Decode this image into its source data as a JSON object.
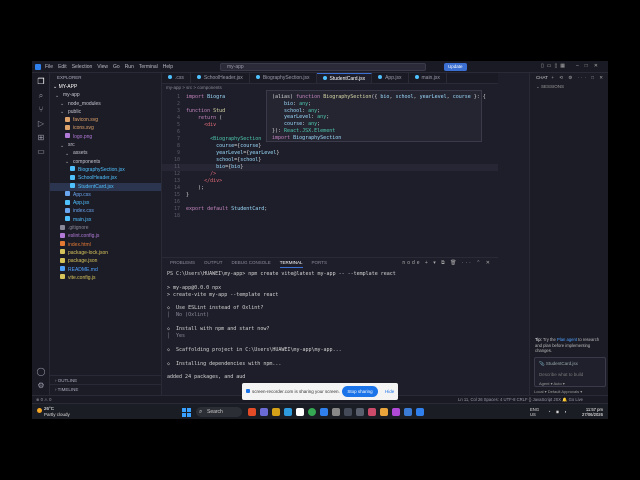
{
  "titlebar": {
    "menu": [
      "File",
      "Edit",
      "Selection",
      "View",
      "Go",
      "Run",
      "Terminal",
      "Help"
    ],
    "search": "my-app",
    "update_label": "Update"
  },
  "explorer": {
    "title": "EXPLORER",
    "root": "MY-APP",
    "items": [
      {
        "label": "my-app",
        "indent": 0,
        "color": "#c5c5d0",
        "kind": "folder"
      },
      {
        "label": "node_modules",
        "indent": 1,
        "color": "#8a8a9a",
        "kind": "folder"
      },
      {
        "label": "public",
        "indent": 1,
        "color": "#c5c5d0",
        "kind": "folder"
      },
      {
        "label": "favicon.svg",
        "indent": 2,
        "color": "#e0a46a",
        "kind": "file"
      },
      {
        "label": "icons.svg",
        "indent": 2,
        "color": "#e0a46a",
        "kind": "file"
      },
      {
        "label": "logo.png",
        "indent": 2,
        "color": "#b07ad6",
        "kind": "file"
      },
      {
        "label": "src",
        "indent": 1,
        "color": "#c5c5d0",
        "kind": "folder"
      },
      {
        "label": "assets",
        "indent": 2,
        "color": "#c5c5d0",
        "kind": "folder"
      },
      {
        "label": "components",
        "indent": 2,
        "color": "#c5c5d0",
        "kind": "folder"
      },
      {
        "label": "BiographySection.jsx",
        "indent": 3,
        "color": "#4fc1ff",
        "kind": "file"
      },
      {
        "label": "SchoolHeader.jsx",
        "indent": 3,
        "color": "#4fc1ff",
        "kind": "file"
      },
      {
        "label": "StudentCard.jsx",
        "indent": 3,
        "color": "#4fc1ff",
        "kind": "file",
        "selected": true
      },
      {
        "label": "App.css",
        "indent": 2,
        "color": "#6aa6f0",
        "kind": "file"
      },
      {
        "label": "App.jsx",
        "indent": 2,
        "color": "#4fc1ff",
        "kind": "file"
      },
      {
        "label": "index.css",
        "indent": 2,
        "color": "#6aa6f0",
        "kind": "file"
      },
      {
        "label": "main.jsx",
        "indent": 2,
        "color": "#4fc1ff",
        "kind": "file"
      },
      {
        "label": ".gitignore",
        "indent": 1,
        "color": "#8a8a9a",
        "kind": "file"
      },
      {
        "label": "eslint.config.js",
        "indent": 1,
        "color": "#b07ad6",
        "kind": "file"
      },
      {
        "label": "index.html",
        "indent": 1,
        "color": "#e37933",
        "kind": "file"
      },
      {
        "label": "package-lock.json",
        "indent": 1,
        "color": "#d6c35a",
        "kind": "file"
      },
      {
        "label": "package.json",
        "indent": 1,
        "color": "#d6c35a",
        "kind": "file"
      },
      {
        "label": "README.md",
        "indent": 1,
        "color": "#4fa3ff",
        "kind": "file"
      },
      {
        "label": "vite.config.js",
        "indent": 1,
        "color": "#d6c35a",
        "kind": "file"
      }
    ],
    "outline": "OUTLINE",
    "timeline": "TIMELINE"
  },
  "tabs": [
    {
      "label": ".css"
    },
    {
      "label": "SchoolHeader.jsx"
    },
    {
      "label": "BiographySection.jsx"
    },
    {
      "label": "StudentCard.jsx",
      "active": true
    },
    {
      "label": "App.jsx"
    },
    {
      "label": "main.jsx"
    }
  ],
  "breadcrumb": "my-app > src > components",
  "editor": {
    "lines": [
      {
        "n": "1",
        "html": "<span class='kw'>import</span> <span class='at'>Biogra</span>"
      },
      {
        "n": "2",
        "html": ""
      },
      {
        "n": "3",
        "html": "<span class='kw'>function</span> <span class='fn'>Stud</span>"
      },
      {
        "n": "4",
        "html": "    <span class='kw'>return</span> ("
      },
      {
        "n": "5",
        "html": "      <span class='tg'>&lt;div</span>"
      },
      {
        "n": "6",
        "html": ""
      },
      {
        "n": "7",
        "html": "        <span class='jx'>&lt;BiographySection</span>"
      },
      {
        "n": "8",
        "html": "          <span class='at'>course</span>={<span class='at'>course</span>}"
      },
      {
        "n": "9",
        "html": "          <span class='at'>yearLevel</span>={<span class='at'>yearLevel</span>}"
      },
      {
        "n": "10",
        "html": "          <span class='at'>school</span>={<span class='at'>school</span>}"
      },
      {
        "n": "11",
        "html": "          <span class='at'>bio</span>={<span class='at'>bio</span>}",
        "current": true
      },
      {
        "n": "12",
        "html": "        <span class='tg'>/&gt;</span>"
      },
      {
        "n": "13",
        "html": "      <span class='tg'>&lt;/div&gt;</span>"
      },
      {
        "n": "14",
        "html": "    );"
      },
      {
        "n": "15",
        "html": "}"
      },
      {
        "n": "16",
        "html": ""
      },
      {
        "n": "17",
        "html": "<span class='kw'>export default</span> <span class='at'>StudentCard</span>;"
      },
      {
        "n": "18",
        "html": ""
      }
    ],
    "hover": [
      "<span class='pl'>(alias) </span><span class='kw'>function</span> <span class='fn'>BiographySection</span>({ <span class='at'>bio</span>, <span class='at'>school</span>, <span class='at'>yearLevel</span>, <span class='at'>course</span> }: {",
      "    <span class='at'>bio</span>: <span class='jx'>any</span>;",
      "    <span class='at'>school</span>: <span class='jx'>any</span>;",
      "    <span class='at'>yearLevel</span>: <span class='jx'>any</span>;",
      "    <span class='at'>course</span>: <span class='jx'>any</span>;",
      "}): <span class='jx'>React.JSX.Element</span>",
      "<span class='kw'>import</span> <span class='at'>BiographySection</span>"
    ]
  },
  "panel": {
    "tabs": [
      "PROBLEMS",
      "OUTPUT",
      "DEBUG CONSOLE",
      "TERMINAL",
      "PORTS"
    ],
    "active_tab": "TERMINAL",
    "tools": "node + ▾ ⧉ 🗑 ··· ⌃ ✕",
    "terminal": [
      {
        "text": "PS C:\\Users\\HUAWEI\\my-app> npm create vite@latest my-app -- --template react",
        "dim": false
      },
      {
        "text": "",
        "dim": false
      },
      {
        "text": "> my-app@0.0.0 npx",
        "dim": false
      },
      {
        "text": "> create-vite my-app --template react",
        "dim": false
      },
      {
        "text": "",
        "dim": false
      },
      {
        "text": "◇  Use ESLint instead of Oxlint?",
        "dim": false
      },
      {
        "text": "│  No (Oxlint)",
        "dim": true
      },
      {
        "text": "",
        "dim": false
      },
      {
        "text": "◇  Install with npm and start now?",
        "dim": false
      },
      {
        "text": "│  Yes",
        "dim": true
      },
      {
        "text": "",
        "dim": false
      },
      {
        "text": "◇  Scaffolding project in C:\\Users\\HUAWEI\\my-app\\my-app...",
        "dim": false
      },
      {
        "text": "",
        "dim": false
      },
      {
        "text": "◇  Installing dependencies with npm...",
        "dim": false
      },
      {
        "text": "",
        "dim": false
      },
      {
        "text": "added 24 packages, and aud",
        "dim": false
      }
    ]
  },
  "share": {
    "text": "screen-recorder.com is sharing your screen.",
    "stop": "Stop sharing",
    "hide": "Hide"
  },
  "chat": {
    "title": "CHAT",
    "sessions": "SESSIONS",
    "tip_prefix": "Tip:",
    "tip_text1": " Try the ",
    "tip_link": "Plan agent",
    "tip_text2": " to research and plan before implementing changes.",
    "file_chip": "StudentCard.jsx",
    "placeholder": "Describe what to build",
    "footer": "Agent ▾   Auto ▾",
    "bottom": "Local ▾   Default Approvals ▾"
  },
  "statusbar": {
    "left": "⊗ 0 ⚠ 0",
    "right": "Ln 11, Col 26   Spaces: 4   UTF-8   CRLF   {} JavaScript JSX   🔔 Go Live"
  },
  "taskbar": {
    "temp": "26°C",
    "weather": "Partly cloudy",
    "search": "Search",
    "lang1": "ENG",
    "lang2": "US",
    "time": "11:57 pm",
    "date": "27/06/2026"
  }
}
